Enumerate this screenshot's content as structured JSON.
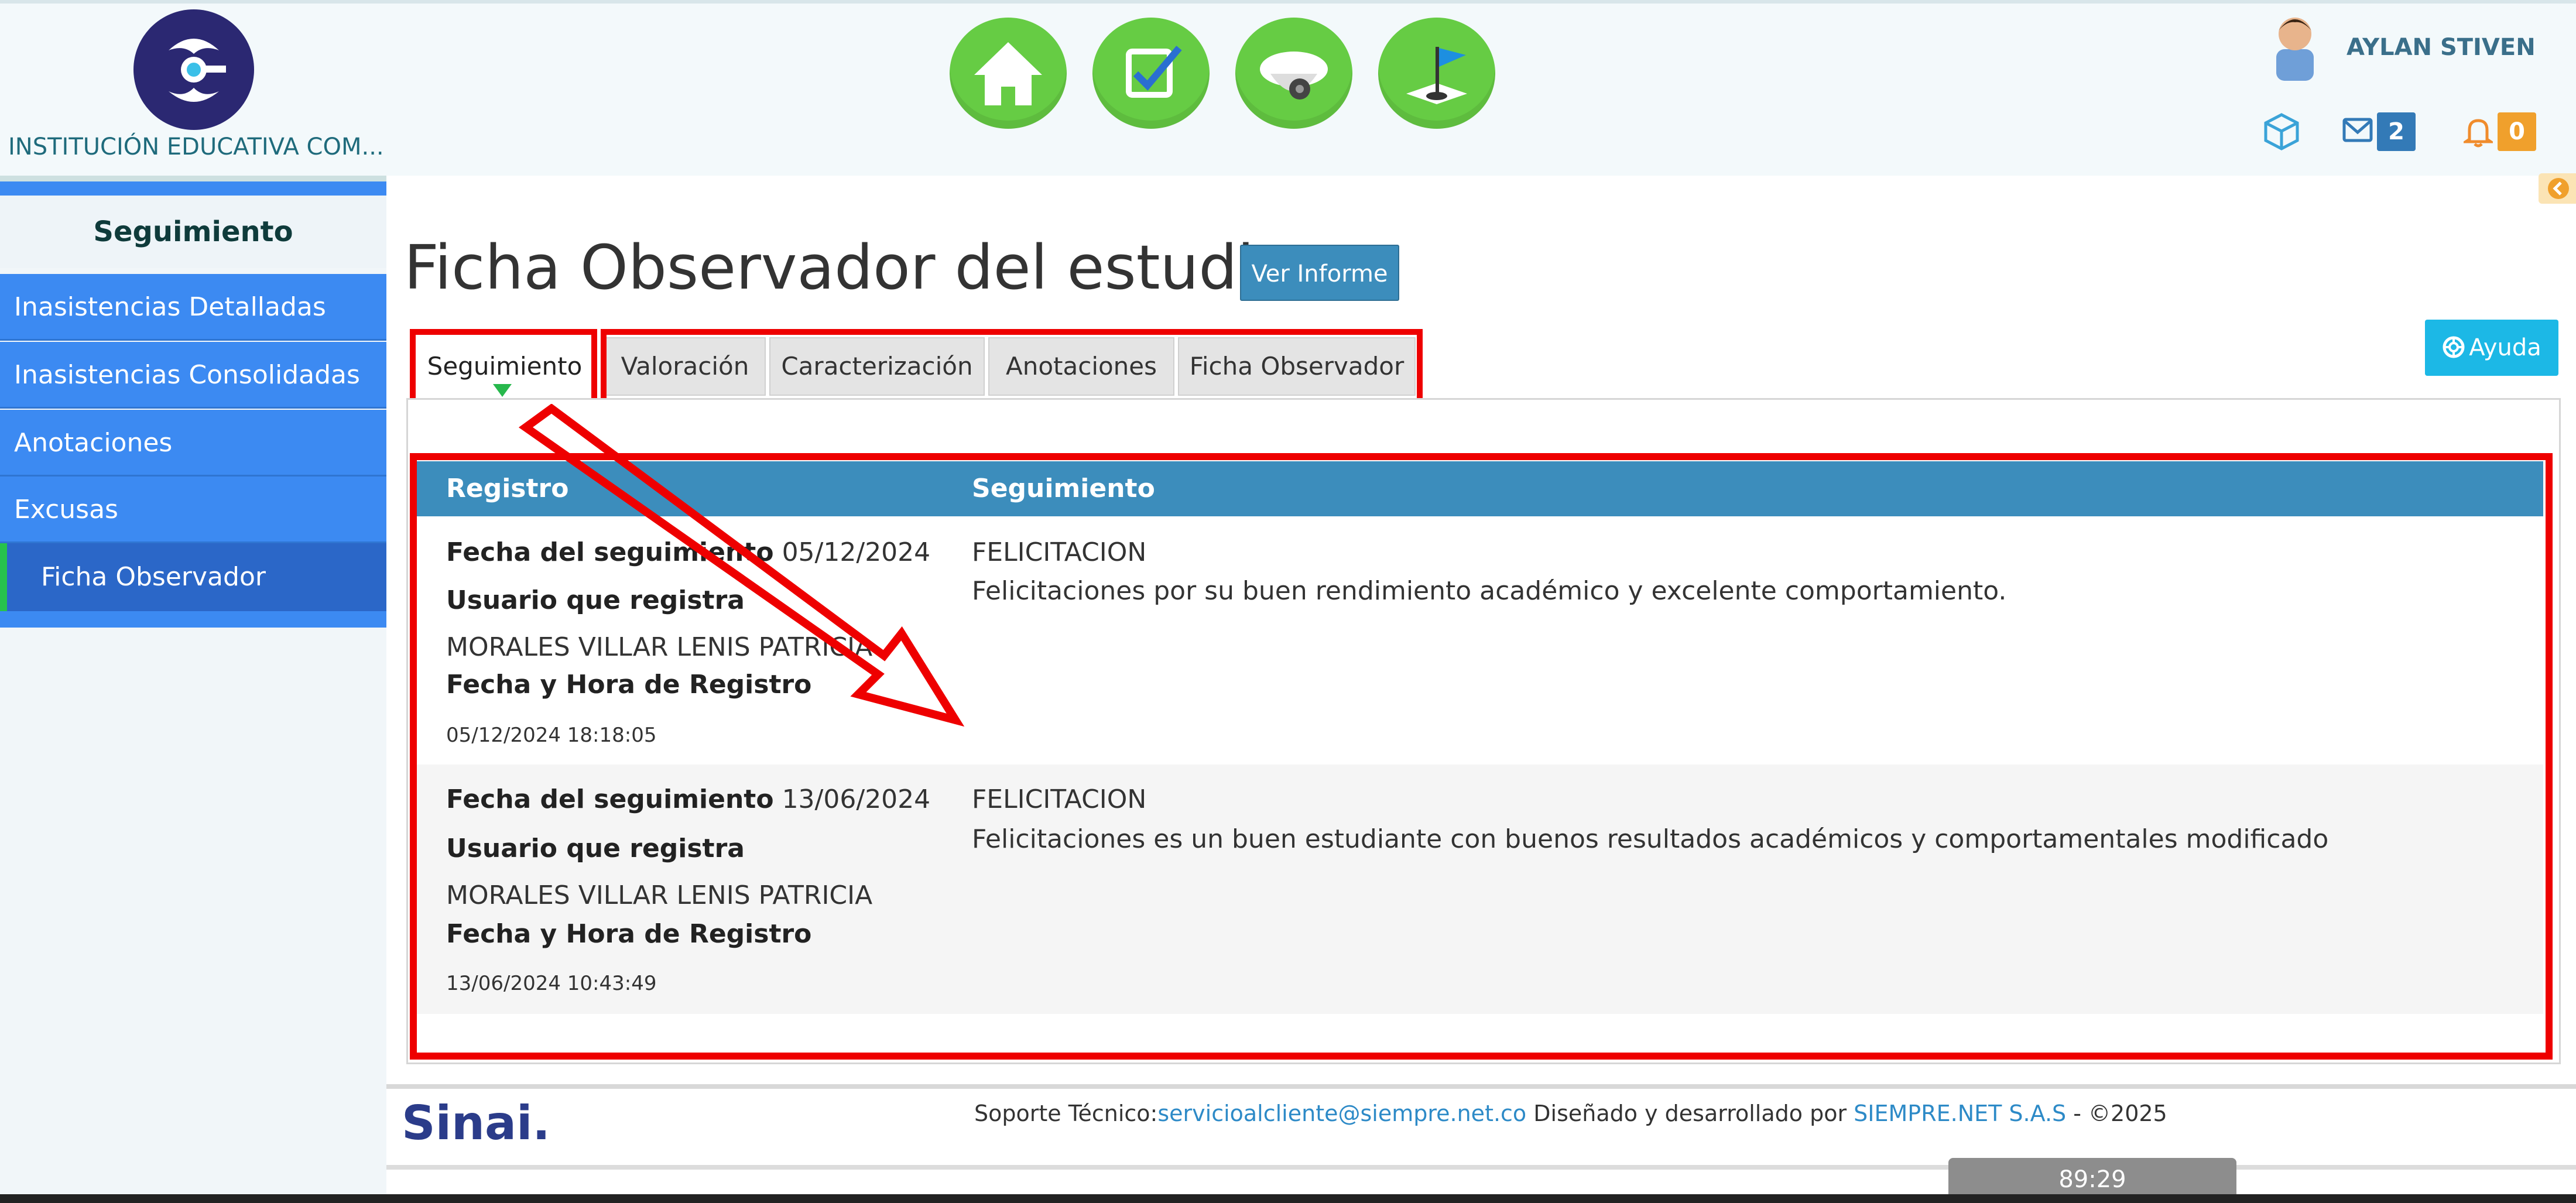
{
  "header": {
    "institution_name": "INSTITUCIÓN EDUCATIVA COM...",
    "user_name": "AYLAN STIVEN",
    "messages_count": "2",
    "notifications_count": "0",
    "modules": [
      {
        "name": "home-icon"
      },
      {
        "name": "checkbox-icon"
      },
      {
        "name": "camera-icon"
      },
      {
        "name": "flag-icon"
      }
    ]
  },
  "sidebar": {
    "title": "Seguimiento",
    "items": [
      {
        "label": "Inasistencias Detalladas"
      },
      {
        "label": "Inasistencias Consolidadas"
      },
      {
        "label": "Anotaciones"
      },
      {
        "label": "Excusas"
      },
      {
        "label": "Ficha Observador"
      }
    ]
  },
  "main": {
    "title": "Ficha Observador del estudiante",
    "ver_informe_label": "Ver Informe",
    "ayuda_label": "Ayuda",
    "tabs": [
      {
        "label": "Seguimiento"
      },
      {
        "label": "Valoración"
      },
      {
        "label": "Caracterización"
      },
      {
        "label": "Anotaciones"
      },
      {
        "label": "Ficha Observador"
      }
    ],
    "table": {
      "headers": [
        "Registro",
        "Seguimiento"
      ],
      "labels": {
        "fecha_seguimiento": "Fecha del seguimiento",
        "usuario_registra": "Usuario que registra",
        "fecha_hora_registro": "Fecha y Hora de Registro"
      },
      "rows": [
        {
          "fecha": "05/12/2024",
          "usuario": "MORALES VILLAR LENIS PATRICIA",
          "fecha_hora": "05/12/2024 18:18:05",
          "tipo": "FELICITACION",
          "descripcion": "Felicitaciones por su buen rendimiento académico y excelente comportamiento."
        },
        {
          "fecha": "13/06/2024",
          "usuario": "MORALES VILLAR LENIS PATRICIA",
          "fecha_hora": "13/06/2024 10:43:49",
          "tipo": "FELICITACION",
          "descripcion": "Felicitaciones es un buen estudiante con buenos resultados académicos y comportamentales modificado"
        }
      ]
    }
  },
  "footer": {
    "logo_text": "Sinai.",
    "support_label": "Soporte Técnico:",
    "support_email": "servicioalcliente@siempre.net.co",
    "designed_by": " Diseñado y desarrollado por ",
    "company": "SIEMPRE.NET S.A.S",
    "copyright": " -  ©2025",
    "timer": "89:29"
  },
  "colors": {
    "sidebar_blue": "#3c8af2",
    "table_header": "#3c8dbc",
    "highlight_red": "#ee0000",
    "module_green": "#66cc44"
  }
}
